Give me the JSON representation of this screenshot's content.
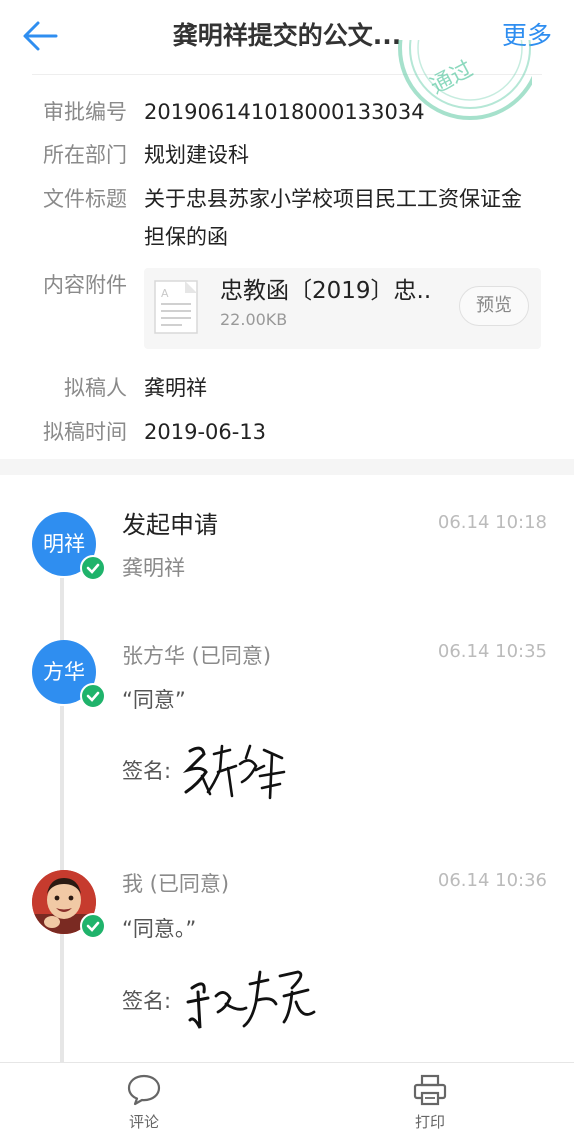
{
  "header": {
    "title": "龚明祥提交的公文...",
    "more": "更多"
  },
  "info": {
    "approval_no_label": "审批编号",
    "approval_no": "2019061410180001330​34",
    "department_label": "所在部门",
    "department": "规划建设科",
    "doc_title_label": "文件标题",
    "doc_title": "关于忠县苏家小学校项目民工工资保证金担保的函",
    "attachment_label": "内容附件",
    "drafter_label": "拟稿人",
    "drafter": "龚明祥",
    "draft_time_label": "拟稿时间",
    "draft_time": "2019-06-13",
    "stamp_text": "通过"
  },
  "attachment": {
    "name": "忠教函〔2019〕忠..",
    "size": "22.00KB",
    "preview_label": "预览"
  },
  "timeline": [
    {
      "avatar_text": "明祥",
      "title": "发起申请",
      "name": "龚明祥",
      "time": "06.14 10:18"
    },
    {
      "avatar_text": "方华",
      "title": "张方华 (已同意)",
      "comment": "“同意”",
      "signature_label": "签名:",
      "time": "06.14 10:35"
    },
    {
      "title": "我 (已同意)",
      "comment": "“同意。”",
      "signature_label": "签名:",
      "time": "06.14 10:36"
    }
  ],
  "bottom_bar": {
    "comment_label": "评论",
    "print_label": "打印"
  },
  "colors": {
    "accent": "#2f8ef0",
    "check": "#1fb36b",
    "stamp": "#5cc9a3"
  }
}
